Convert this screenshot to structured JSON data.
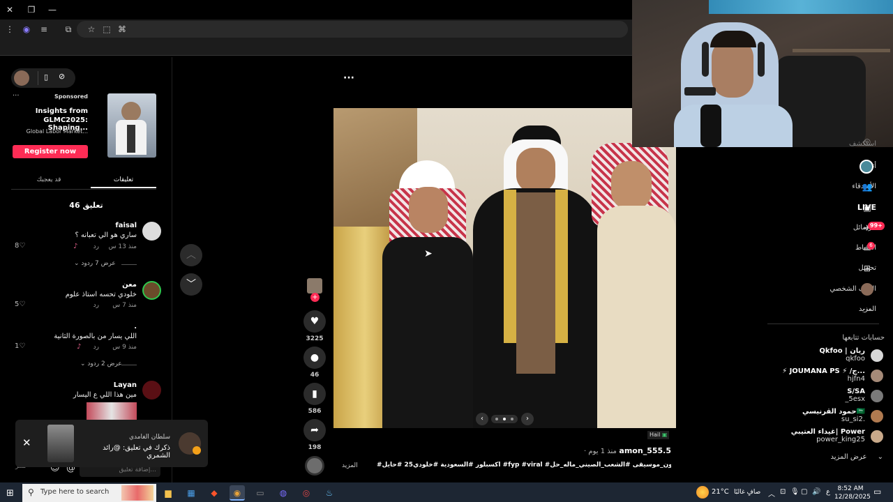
{
  "ad": {
    "sponsored": "Sponsored",
    "line1": "Insights from",
    "line2": "GLMC2025: Shaping...",
    "line3": "Global Labor Market...",
    "register": "Register now"
  },
  "tabs": {
    "comments": "تعليقات",
    "you_may_like": "قد يعجبك"
  },
  "comments_count": "46 تعليق",
  "comments": [
    {
      "name": "faisal",
      "text": "ساري هو الي تعبانه ؟",
      "time": "منذ 13 س",
      "reply": "رد",
      "likes": "8",
      "view_replies": "عرض 7 ردود"
    },
    {
      "name": "معن",
      "text": "خلودي تحسه استاذ علوم",
      "time": "منذ 7 س",
      "reply": "رد",
      "likes": "5"
    },
    {
      "name": ".",
      "text": "اللي يسار من بالصورة الثانية",
      "time": "منذ 9 س",
      "reply": "رد",
      "likes": "1",
      "view_replies": "عرض 2 ردود"
    },
    {
      "name": "Layan",
      "text": "مين هذا اللي ع اليسار"
    }
  ],
  "toast": {
    "title": "سلطان الغامدي",
    "text": "ذكرك في تعليق: @رائد الشمري"
  },
  "comment_input": {
    "placeholder": "إضافة تعليق..."
  },
  "comment_footer": "نشر",
  "actions": {
    "likes": "3225",
    "comments": "46",
    "saves": "586",
    "shares": "198"
  },
  "video": {
    "author": "amon_555.5",
    "time": "· منذ 1 يوم",
    "location": "Hail",
    "caption": "#اكسبلور #السعودية #خلودي25 #حايل #fyp #viral #بدون_موسيقى #الشعب_الصيني_ماله_حل 😂😂 ...",
    "more": "المزيد"
  },
  "sidebar": {
    "items": [
      {
        "label": "استكشف",
        "icon": "compass-icon"
      },
      {
        "label": "أتابعه",
        "icon": "following-icon"
      },
      {
        "label": "الأصدقاء",
        "icon": "friends-icon"
      },
      {
        "label": "LIVE",
        "icon": "live-icon"
      },
      {
        "label": "الرسائل",
        "icon": "messages-icon",
        "badge": "99+"
      },
      {
        "label": "النشاط",
        "icon": "activity-icon",
        "badge": "6"
      },
      {
        "label": "تحميل",
        "icon": "upload-icon"
      },
      {
        "label": "الملف الشخصي",
        "icon": "profile-icon"
      },
      {
        "label": "المزيد",
        "icon": "more-icon"
      }
    ],
    "following_title": "حسابات تتابعها",
    "following": [
      {
        "name": "Qkfoo | ريان",
        "id": "qkfoo"
      },
      {
        "name": "⚡ JOUMANA PS ⚡ /ج...",
        "id": "hjfn4"
      },
      {
        "name": "S/SA",
        "id": "_5esx"
      },
      {
        "name": "حمود القرنيسي🇸🇦",
        "id": "su_si2."
      },
      {
        "name": "غيداء العتيبي| Power",
        "id": "power_king25"
      }
    ],
    "show_more": "عرض المزيد"
  },
  "taskbar": {
    "search_placeholder": "Type here to search",
    "weather_temp": "21°C",
    "weather_text": "صافٍ غالبًا",
    "lang": "ع",
    "time": "8:52 AM",
    "date": "12/28/2025"
  },
  "colors": {
    "accent": "#fe2c55",
    "bg": "#000000",
    "taskbar": "#1d2633"
  }
}
